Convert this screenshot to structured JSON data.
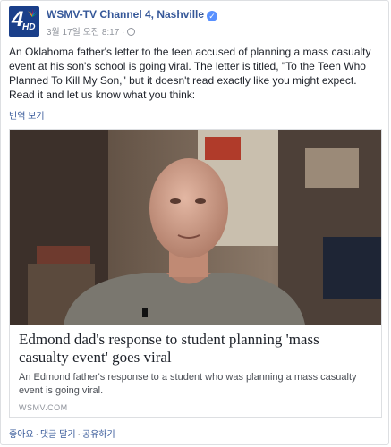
{
  "post": {
    "page_name": "WSMV-TV Channel 4, Nashville",
    "logo_text": "4",
    "logo_sub": "HD",
    "timestamp": "3월 17일 오전 8:17 ·",
    "text": "An Oklahoma father's letter to the teen accused of planning a mass casualty event at his son's school is going viral. The letter is titled, \"To the Teen Who Planned To Kill My Son,\" but it doesn't read exactly like you might expect. Read it and let us know what you think:",
    "translate_label": "번역 보기"
  },
  "link": {
    "title": "Edmond dad's response to student planning 'mass casualty event' goes viral",
    "description": "An Edmond father's response to a student who was planning a mass casualty event is going viral.",
    "domain": "WSMV.COM",
    "image_icon": "video-thumbnail-man"
  },
  "actions": {
    "like": "좋아요",
    "comment": "댓글 달기",
    "share": "공유하기",
    "separator": "·"
  },
  "colors": {
    "link_blue": "#365899",
    "meta_gray": "#90949c",
    "verified_blue": "#5890ff"
  }
}
